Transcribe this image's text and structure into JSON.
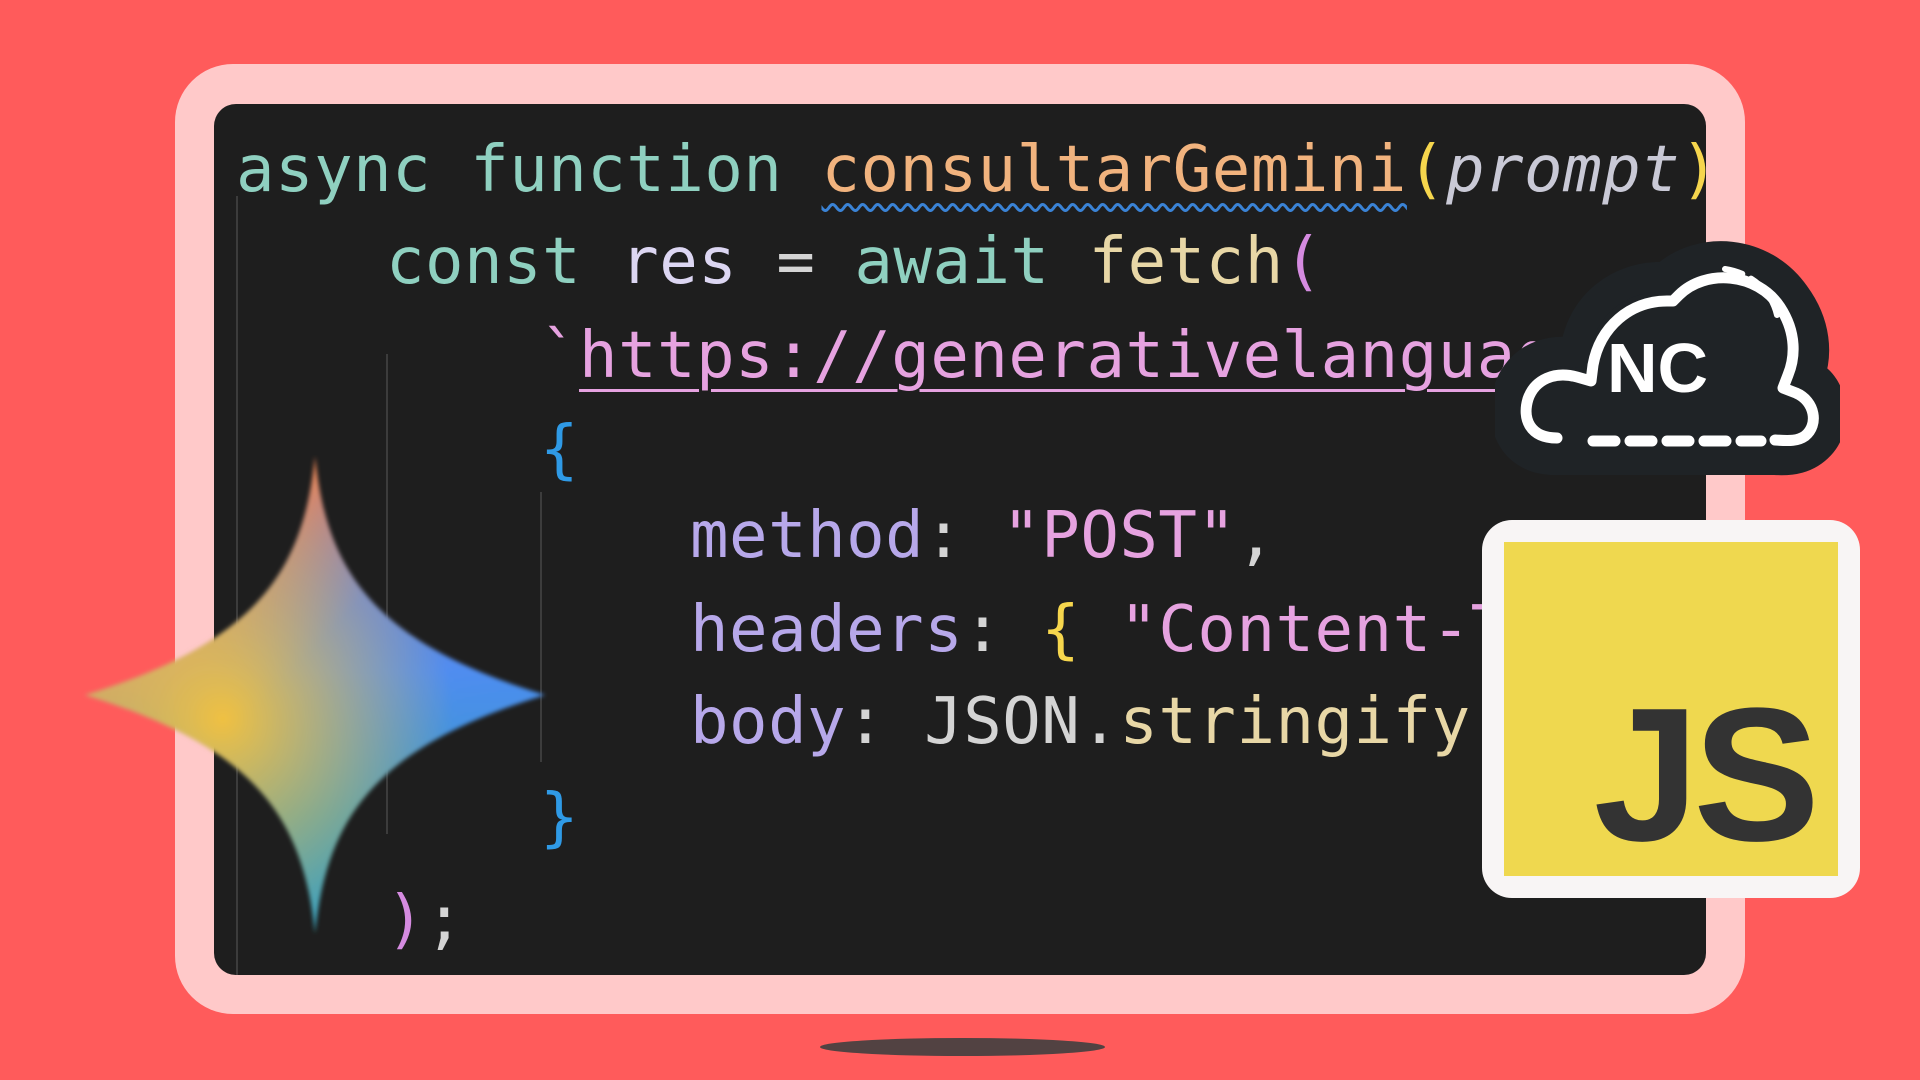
{
  "code": {
    "line1": {
      "kw_async": "async",
      "kw_function": "function",
      "fn_name": "consultarGemini",
      "paren_open": "(",
      "param": "prompt",
      "paren_close": ")"
    },
    "line2": {
      "kw_const": "const",
      "var": "res",
      "eq": "=",
      "kw_await": "await",
      "fn_fetch": "fetch",
      "paren": "("
    },
    "line3": {
      "backtick": "`",
      "url": "https://generativelanguag"
    },
    "line4": {
      "brace": "{"
    },
    "line5": {
      "prop": "method",
      "colon": ":",
      "value": "\"POST\"",
      "comma": ","
    },
    "line6": {
      "prop": "headers",
      "colon": ":",
      "brace": "{",
      "value": "\"Content-T"
    },
    "line7": {
      "prop": "body",
      "colon": ":",
      "obj": "JSON",
      "dot": ".",
      "method": "stringify",
      "paren": "("
    },
    "line8": {
      "brace": "}"
    },
    "line9": {
      "paren": ")",
      "semicolon": ";"
    }
  },
  "logos": {
    "cloud_text": "NC",
    "js_text": "JS",
    "star_icon": "gemini-star-icon"
  },
  "colors": {
    "background": "#ff5b5b",
    "frame": "#ffc9c9",
    "screen": "#1e1e1e",
    "js_yellow": "#efd84f"
  }
}
